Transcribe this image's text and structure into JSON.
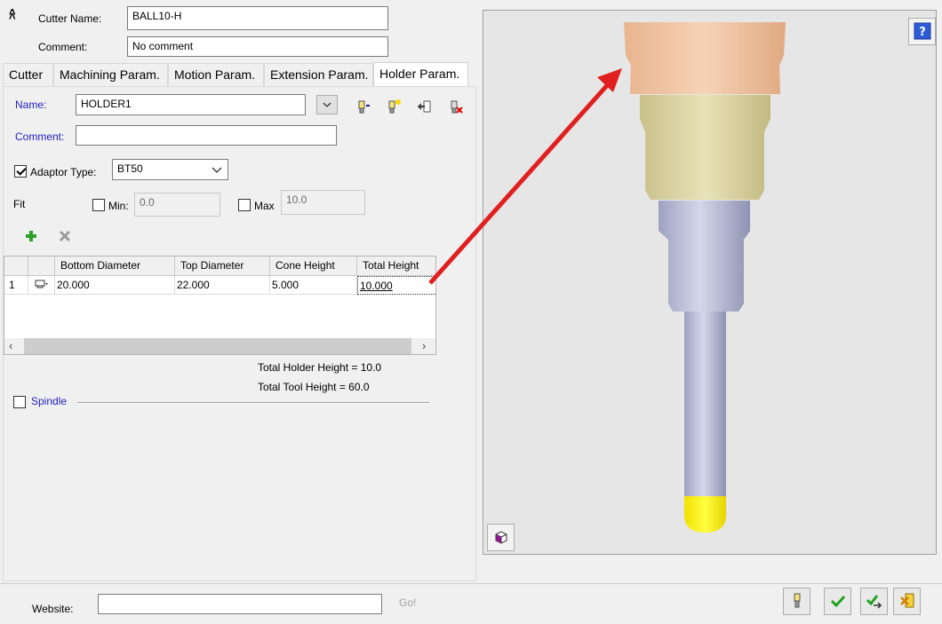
{
  "header": {
    "collapse_icon": "double-chevron-up-icon",
    "cutter_name_label": "Cutter Name:",
    "cutter_name_value": "BALL10-H",
    "comment_label": "Comment:",
    "comment_value": "No comment"
  },
  "tabs": [
    {
      "label": "Cutter",
      "active": false
    },
    {
      "label": "Machining Param.",
      "active": false
    },
    {
      "label": "Motion Param.",
      "active": false
    },
    {
      "label": "Extension Param.",
      "active": false
    },
    {
      "label": "Holder Param.",
      "active": true
    }
  ],
  "holder": {
    "name_label": "Name:",
    "name_value": "HOLDER1",
    "comment_label": "Comment:",
    "comment_value": "",
    "adaptor_label": "Adaptor Type:",
    "adaptor_checked": true,
    "adaptor_value": "BT50",
    "fit_label": "Fit",
    "min_label": "Min:",
    "min_value": "0.0",
    "max_label": "Max",
    "max_value": "10.0",
    "table": {
      "columns": [
        "",
        "",
        "Bottom Diameter",
        "Top Diameter",
        "Cone Height",
        "Total Height"
      ],
      "rows": [
        {
          "index": "1",
          "type_icon": "holder-segment-icon",
          "bottom_diameter": "20.000",
          "top_diameter": "22.000",
          "cone_height": "5.000",
          "total_height": "10.000"
        }
      ]
    },
    "total_holder_height": "Total Holder Height = 10.0",
    "total_tool_height": "Total Tool Height = 60.0",
    "spindle_label": "Spindle"
  },
  "footer": {
    "website_label": "Website:",
    "website_value": "",
    "go_label": "Go!"
  },
  "colors": {
    "holder_top": "#f2c9a6",
    "adaptor": "#dcd6a8",
    "shank": "#b8bcd6",
    "ball": "#ffee00",
    "arrow": "#e02020",
    "label_blue": "#1f1fbf"
  }
}
